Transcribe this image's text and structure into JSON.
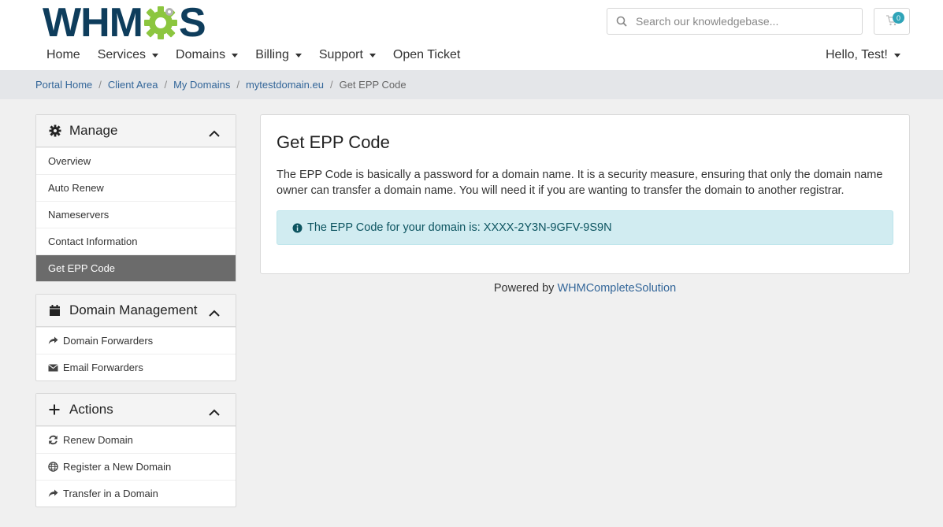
{
  "brand": {
    "logo_text_left": "WHM",
    "logo_text_right": "S",
    "logo_gear_color": "#8cc63f",
    "logo_text_color": "#0e3d5c"
  },
  "header": {
    "search_placeholder": "Search our knowledgebase...",
    "cart_count": "0",
    "nav": [
      {
        "label": "Home",
        "dropdown": false
      },
      {
        "label": "Services",
        "dropdown": true
      },
      {
        "label": "Domains",
        "dropdown": true
      },
      {
        "label": "Billing",
        "dropdown": true
      },
      {
        "label": "Support",
        "dropdown": true
      },
      {
        "label": "Open Ticket",
        "dropdown": false
      }
    ],
    "user_menu": "Hello, Test!"
  },
  "breadcrumb": {
    "items": [
      "Portal Home",
      "Client Area",
      "My Domains",
      "mytestdomain.eu"
    ],
    "active": "Get EPP Code"
  },
  "sidebar": {
    "manage": {
      "title": "Manage",
      "icon": "gear-icon",
      "items": [
        "Overview",
        "Auto Renew",
        "Nameservers",
        "Contact Information",
        "Get EPP Code"
      ],
      "active": "Get EPP Code"
    },
    "domain_management": {
      "title": "Domain Management",
      "icon": "calendar-icon",
      "items": [
        {
          "label": "Domain Forwarders",
          "icon": "share-icon"
        },
        {
          "label": "Email Forwarders",
          "icon": "envelope-icon"
        }
      ]
    },
    "actions": {
      "title": "Actions",
      "icon": "plus-icon",
      "items": [
        {
          "label": "Renew Domain",
          "icon": "refresh-icon"
        },
        {
          "label": "Register a New Domain",
          "icon": "globe-icon"
        },
        {
          "label": "Transfer in a Domain",
          "icon": "share-icon"
        }
      ]
    }
  },
  "main": {
    "title": "Get EPP Code",
    "description": "The EPP Code is basically a password for a domain name. It is a security measure, ensuring that only the domain name owner can transfer a domain name. You will need it if you are wanting to transfer the domain to another registrar.",
    "alert_text": "The EPP Code for your domain is: XXXX-2Y3N-9GFV-9S9N"
  },
  "footer": {
    "prefix": "Powered by",
    "link": "WHMCompleteSolution"
  },
  "colors": {
    "link": "#336699",
    "active_item_bg": "#6b6b6b",
    "alert_bg": "#d1ecf1",
    "alert_text": "#0c5460",
    "badge": "#2fa4b8"
  }
}
